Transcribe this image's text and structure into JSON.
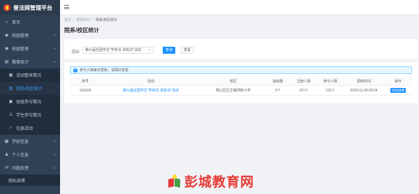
{
  "app": {
    "title": "普法网管理平台"
  },
  "sidebar": {
    "items": [
      {
        "label": "首页",
        "icon": "home-icon"
      },
      {
        "label": "校园管理",
        "icon": "school-icon"
      },
      {
        "label": "校园管理",
        "icon": "school-icon"
      },
      {
        "label": "赛事统计",
        "icon": "stats-icon"
      }
    ],
    "subitems": [
      {
        "label": "活动整体情况"
      },
      {
        "label": "院系/校区统计"
      },
      {
        "label": "班级参与情况"
      },
      {
        "label": "学生参与情况"
      },
      {
        "label": "往届活动"
      }
    ],
    "bottom_items": [
      {
        "label": "学校信息",
        "icon": "school-info-icon"
      },
      {
        "label": "个人信息",
        "icon": "user-icon"
      },
      {
        "label": "问题反馈",
        "icon": "feedback-icon"
      }
    ],
    "last_sub": "隐私政策"
  },
  "breadcrumb": {
    "items": [
      "首页",
      "赛事统计",
      "院系/校区统计"
    ]
  },
  "page": {
    "title": "院系/校区统计"
  },
  "filter": {
    "label": "活动:",
    "selected": "第九届全国学生\"学宪法 讲宪法\"活动",
    "query_label": "查询",
    "reset_label": "重置"
  },
  "notice": {
    "text": "参与人数每日更新，请隔日查看"
  },
  "table": {
    "headers": [
      "序号",
      "活动",
      "校区",
      "班级数",
      "注册人数",
      "参与人数",
      "更新时间",
      "操作"
    ],
    "rows": [
      {
        "id": "106169",
        "activity": "第九届全国学生\"学宪法 讲宪法\"活动",
        "campus": "桐山区区王镇湾新小学",
        "classes": "6个",
        "registered": "167人",
        "participants": "132人",
        "updated": "2024-11-04 09:24",
        "action": "导出详情"
      }
    ]
  },
  "watermark": {
    "text": "彭城教育网"
  }
}
